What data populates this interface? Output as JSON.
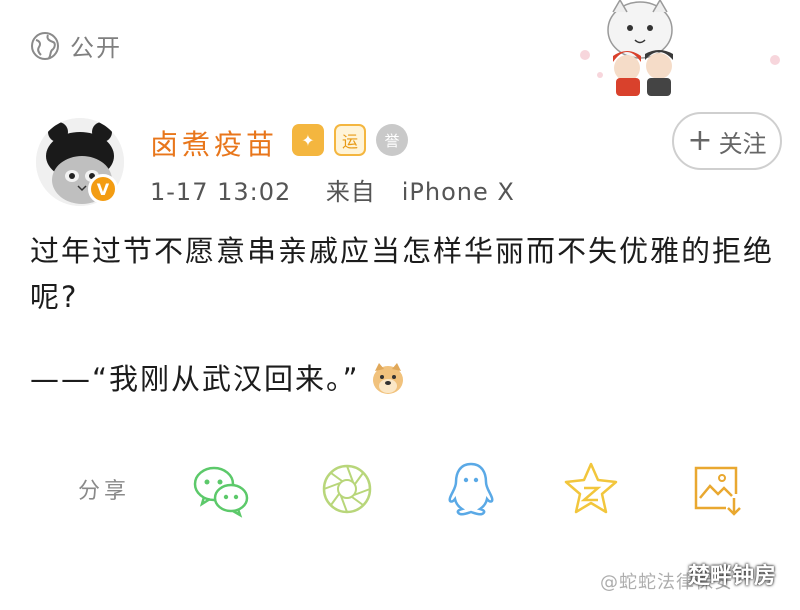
{
  "visibility": {
    "label": "公开",
    "icon": "globe-icon"
  },
  "user": {
    "name": "卤煮疫苗",
    "verified_mark": "V",
    "badges": [
      {
        "type": "crown-badge",
        "text": "✦"
      },
      {
        "type": "yun-badge",
        "text": "运"
      },
      {
        "type": "medal-badge",
        "text": "誉"
      }
    ],
    "name_color": "#e8761b"
  },
  "meta": {
    "time": "1-17 13:02",
    "source_prefix": "来自",
    "source": "iPhone X"
  },
  "follow": {
    "plus": "+",
    "label": "关注"
  },
  "post": {
    "text": "过年过节不愿意串亲戚应当怎样华丽而不失优雅的拒绝呢?",
    "quote": "——“我刚从武汉回来。”"
  },
  "share": {
    "label": "分享",
    "targets": [
      "wechat-icon",
      "moments-icon",
      "qq-icon",
      "qzone-icon",
      "save-image-icon"
    ]
  },
  "watermark": {
    "text": "@蛇蛇法律保安",
    "logo": "楚畔钟房"
  }
}
